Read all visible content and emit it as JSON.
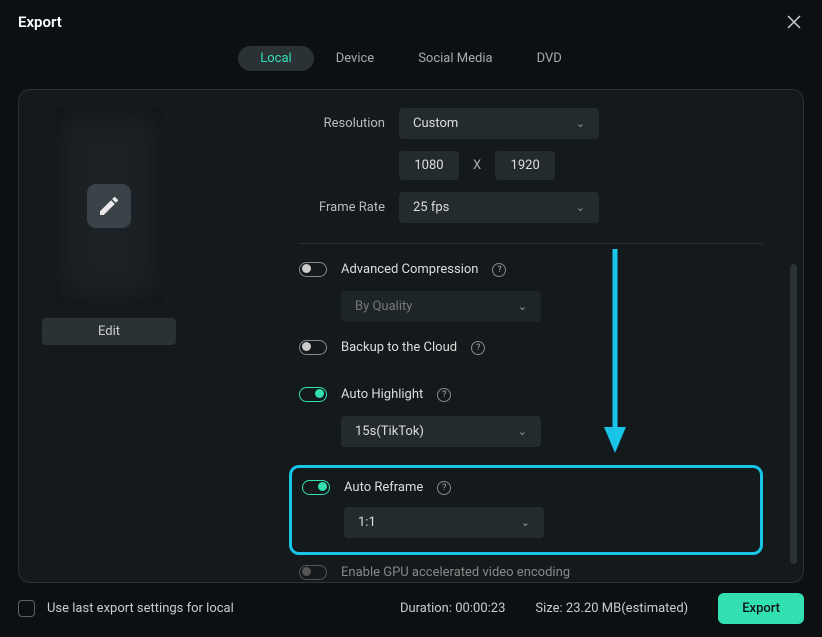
{
  "header": {
    "title": "Export"
  },
  "tabs": [
    {
      "label": "Local",
      "active": true
    },
    {
      "label": "Device",
      "active": false
    },
    {
      "label": "Social Media",
      "active": false
    },
    {
      "label": "DVD",
      "active": false
    }
  ],
  "preview": {
    "edit_label": "Edit"
  },
  "settings": {
    "resolution": {
      "label": "Resolution",
      "value": "Custom",
      "width": "1080",
      "x": "X",
      "height": "1920"
    },
    "framerate": {
      "label": "Frame Rate",
      "value": "25 fps"
    },
    "adv_compression": {
      "label": "Advanced Compression",
      "mode": "By Quality",
      "on": false
    },
    "backup_cloud": {
      "label": "Backup to the Cloud",
      "on": false
    },
    "auto_highlight": {
      "label": "Auto Highlight",
      "value": "15s(TikTok)",
      "on": true
    },
    "auto_reframe": {
      "label": "Auto Reframe",
      "value": "1:1",
      "on": true
    },
    "gpu": {
      "label": "Enable GPU accelerated video encoding",
      "on": false
    }
  },
  "footer": {
    "use_last": "Use last export settings for local",
    "duration_label": "Duration:",
    "duration_value": "00:00:23",
    "size_label": "Size:",
    "size_value": "23.20 MB(estimated)",
    "export_button": "Export"
  }
}
